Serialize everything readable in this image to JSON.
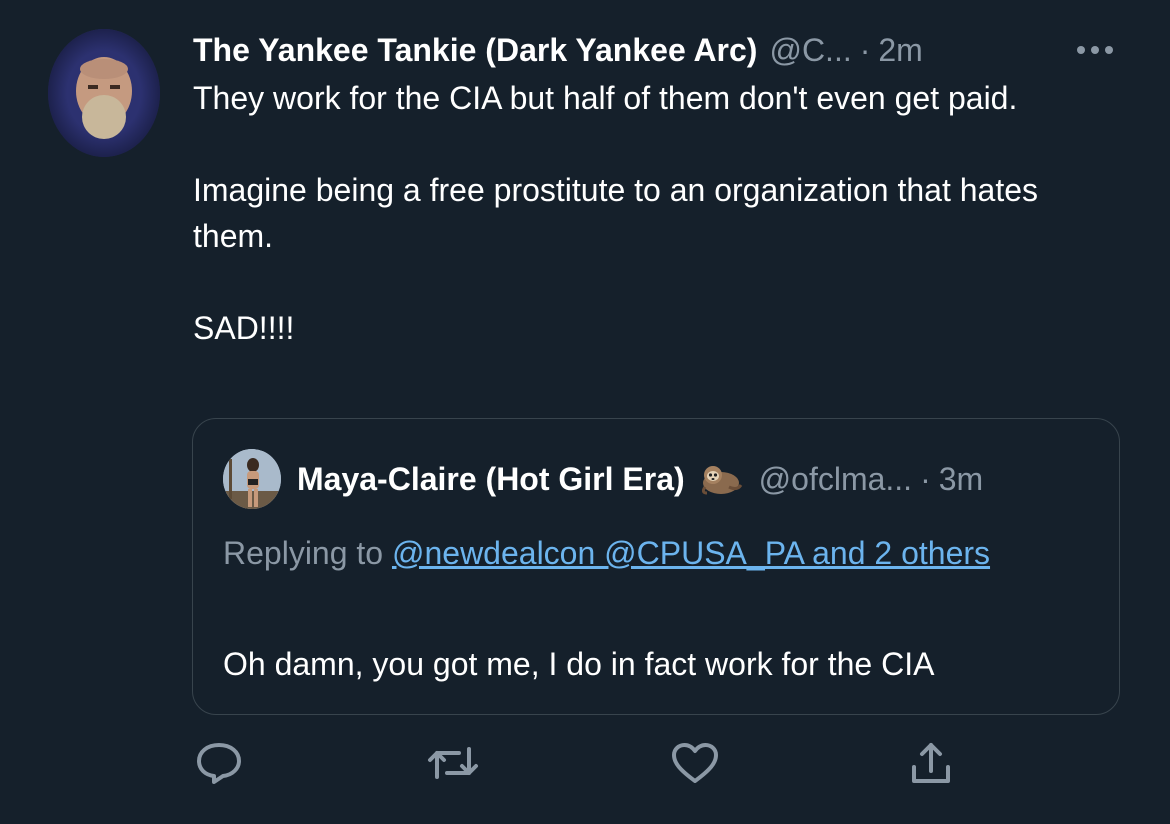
{
  "tweet": {
    "author": {
      "display_name": "The Yankee Tankie (Dark Yankee Arc)",
      "handle": "@C...",
      "separator": "·",
      "time": "2m"
    },
    "more_icon": "more-horizontal-icon",
    "body": {
      "line1": "They work for the CIA but half of them don't even get paid.",
      "line2": "Imagine being a free prostitute to an organization that hates them.",
      "line3": "SAD!!!!"
    },
    "quote": {
      "author": {
        "display_name": "Maya-Claire (Hot Girl Era)",
        "emoji_icon": "sloth-emoji-icon",
        "handle": "@ofclma...",
        "separator": "·",
        "time": "3m"
      },
      "replying_prefix": "Replying to ",
      "mentions": "@newdealcon @CPUSA_PA and 2 others",
      "text": "Oh damn, you got me, I do in fact work for the CIA"
    },
    "actions": {
      "reply_icon": "reply-icon",
      "retweet_icon": "retweet-icon",
      "like_icon": "heart-icon",
      "share_icon": "share-icon"
    }
  },
  "colors": {
    "background": "#15202b",
    "secondary_text": "#8b98a5",
    "link": "#6cb4ee",
    "border": "#38444d"
  }
}
